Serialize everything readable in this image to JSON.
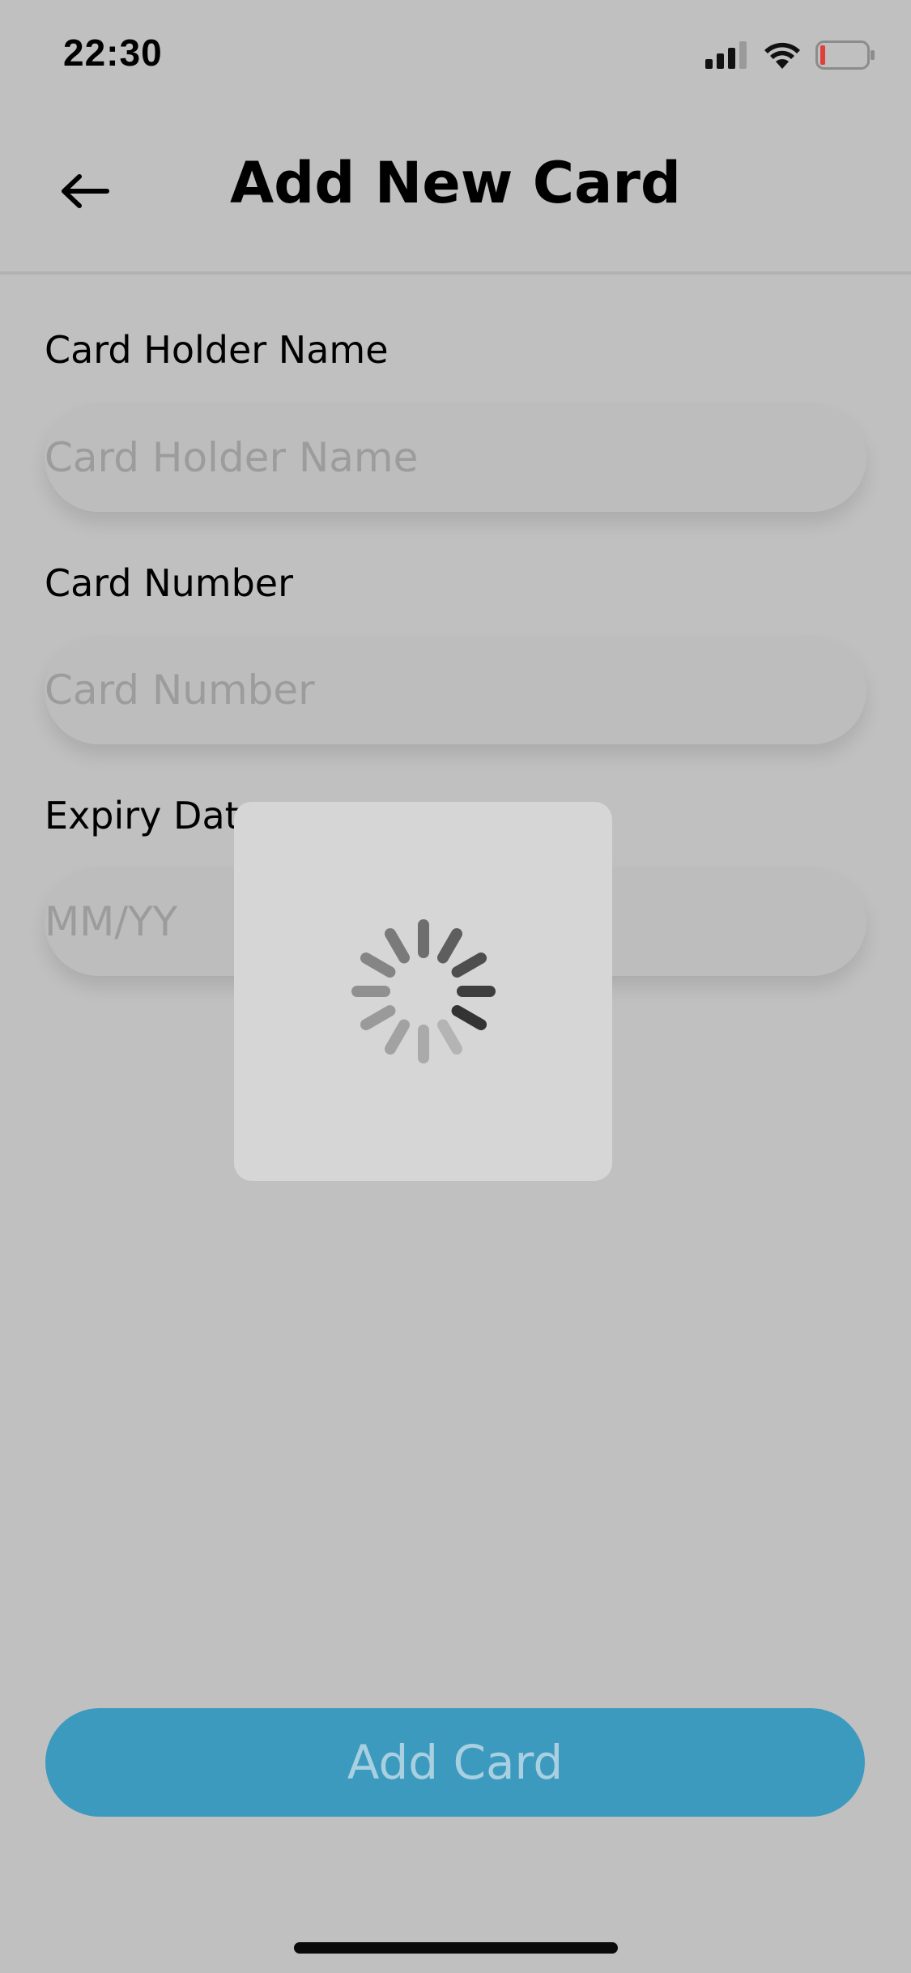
{
  "status_bar": {
    "time": "22:30"
  },
  "header": {
    "title": "Add New Card",
    "back_icon": "arrow-left-icon"
  },
  "form": {
    "card_holder": {
      "label": "Card Holder Name",
      "placeholder": "Card Holder Name",
      "value": ""
    },
    "card_number": {
      "label": "Card Number",
      "placeholder": "Card Number",
      "value": ""
    },
    "expiry": {
      "label": "Expiry Date",
      "placeholder": "MM/YY",
      "value": ""
    }
  },
  "loading": {
    "icon": "spinner-icon"
  },
  "submit": {
    "label": "Add Card"
  },
  "colors": {
    "background": "#c0c0c0",
    "button": "#3d9abf",
    "button_text": "#a9d0e0",
    "battery_low": "#e0403a"
  }
}
